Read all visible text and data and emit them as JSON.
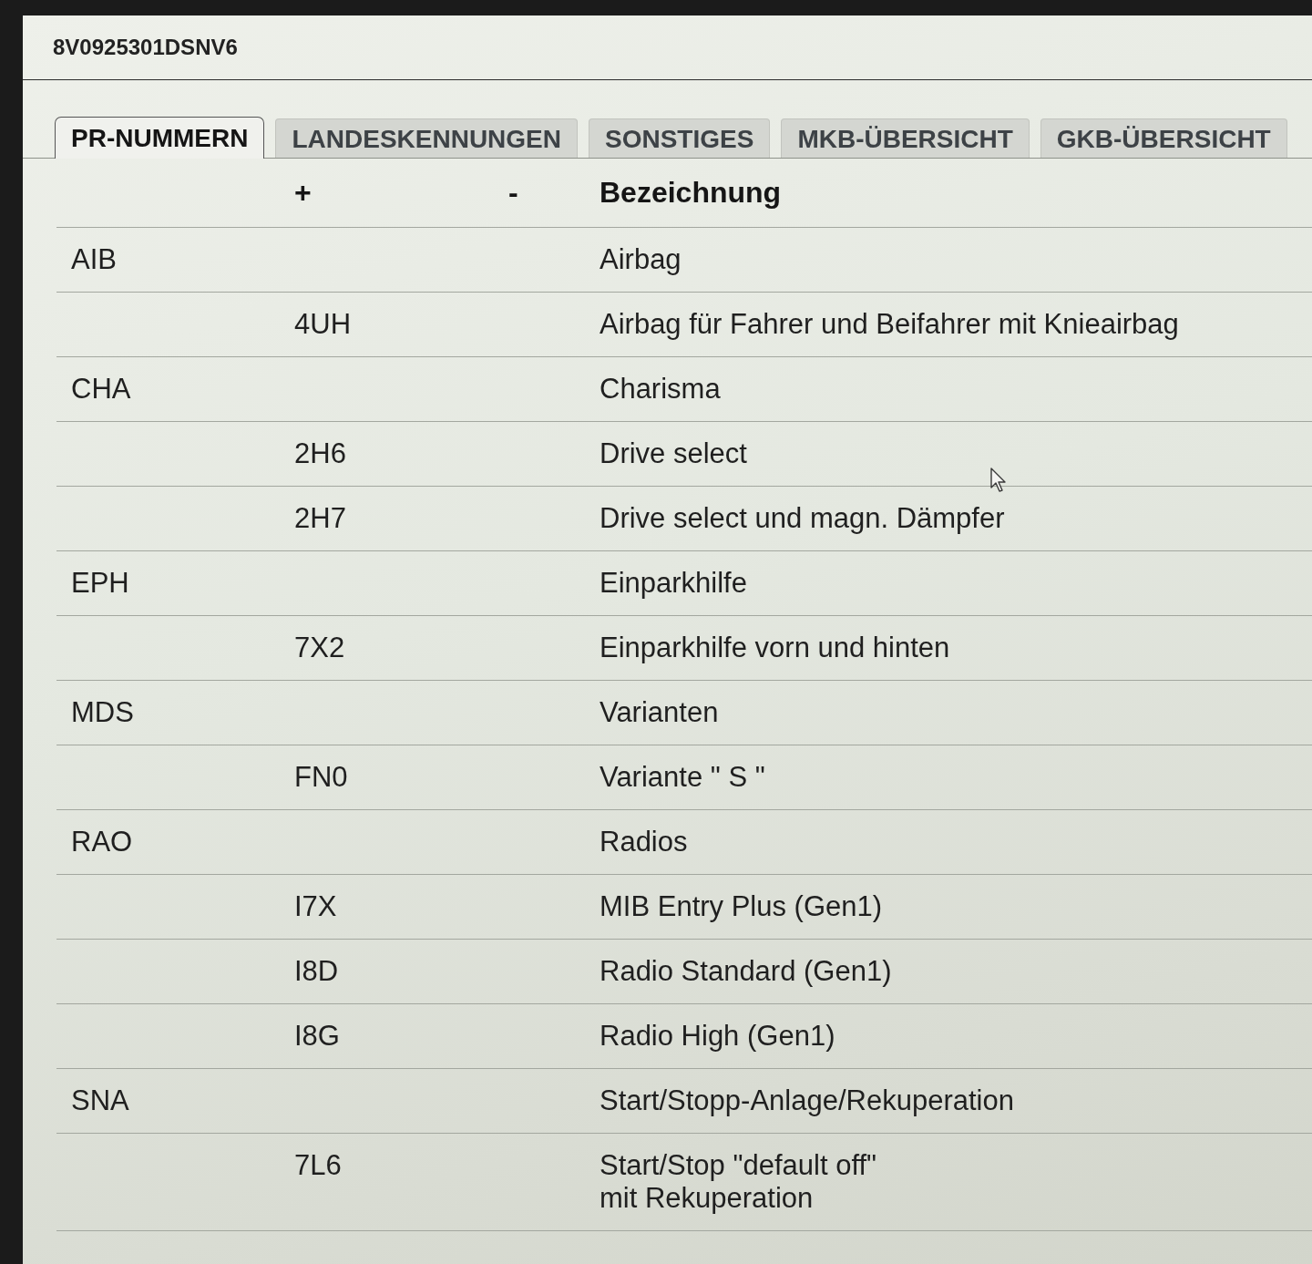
{
  "window": {
    "title": "8V0925301DSNV6"
  },
  "tabs": [
    {
      "label": "PR-NUMMERN",
      "selected": true
    },
    {
      "label": "LANDESKENNUNGEN",
      "selected": false
    },
    {
      "label": "SONSTIGES",
      "selected": false
    },
    {
      "label": "MKB-ÜBERSICHT",
      "selected": false
    },
    {
      "label": "GKB-ÜBERSICHT",
      "selected": false
    }
  ],
  "table": {
    "columns": [
      "+",
      "-",
      "Bezeichnung"
    ],
    "rows": [
      {
        "column_1": "AIB",
        "bezeichnung": "Airbag"
      },
      {
        "plus": "4UH",
        "bezeichnung": "Airbag für Fahrer und Beifahrer mit Knieairbag"
      },
      {
        "column_1": "CHA",
        "bezeichnung": "Charisma"
      },
      {
        "plus": "2H6",
        "bezeichnung": "Drive select"
      },
      {
        "plus": "2H7",
        "bezeichnung": "Drive select und magn. Dämpfer"
      },
      {
        "column_1": "EPH",
        "bezeichnung": "Einparkhilfe"
      },
      {
        "plus": "7X2",
        "bezeichnung": "Einparkhilfe vorn und hinten"
      },
      {
        "column_1": "MDS",
        "bezeichnung": "Varianten"
      },
      {
        "plus": "FN0",
        "bezeichnung": "Variante \" S \""
      },
      {
        "column_1": "RAO",
        "bezeichnung": "Radios"
      },
      {
        "plus": "I7X",
        "bezeichnung": "MIB Entry Plus (Gen1)"
      },
      {
        "plus": "I8D",
        "bezeichnung": "Radio Standard (Gen1)"
      },
      {
        "plus": "I8G",
        "bezeichnung": "Radio High (Gen1)"
      },
      {
        "column_1": "SNA",
        "bezeichnung": "Start/Stopp-Anlage/Rekuperation"
      },
      {
        "plus": "7L6",
        "bezeichnung": "Start/Stop \"default off\"\nmit Rekuperation"
      }
    ]
  }
}
